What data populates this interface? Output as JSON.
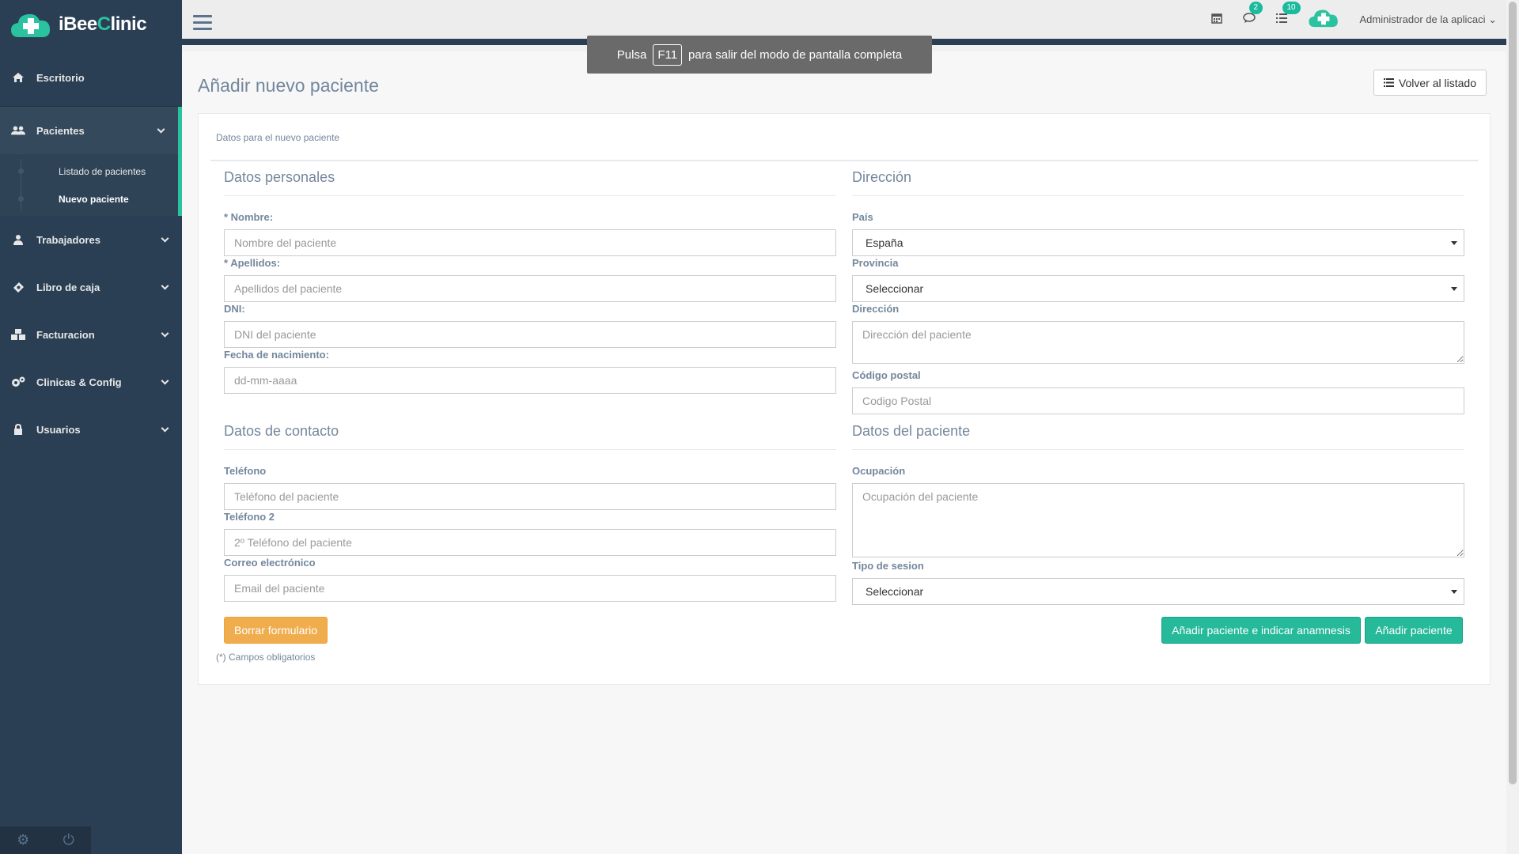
{
  "app": {
    "logo_prefix": "iBee",
    "logo_c": "C",
    "logo_suffix": "linic"
  },
  "sidebar": {
    "items": [
      {
        "label": "Escritorio",
        "icon": "home-icon"
      },
      {
        "label": "Pacientes",
        "icon": "users-icon"
      },
      {
        "label": "Trabajadores",
        "icon": "user-md-icon"
      },
      {
        "label": "Libro de caja",
        "icon": "money-icon"
      },
      {
        "label": "Facturacion",
        "icon": "cubes-icon"
      },
      {
        "label": "Clinicas & Config",
        "icon": "cogs-icon"
      },
      {
        "label": "Usuarios",
        "icon": "lock-icon"
      }
    ],
    "submenu": [
      {
        "label": "Listado de pacientes"
      },
      {
        "label": "Nuevo paciente"
      }
    ]
  },
  "topbar": {
    "messages_count": "2",
    "tasks_count": "10",
    "user_name": "Administrador de la aplicaci"
  },
  "toast": {
    "prefix": "Pulsa",
    "key": "F11",
    "suffix": "para salir del modo de pantalla completa"
  },
  "page": {
    "title": "Añadir nuevo paciente",
    "back_button": "Volver al listado",
    "panel_title": "Datos para el nuevo paciente"
  },
  "personal": {
    "title": "Datos personales",
    "nombre_label": "* Nombre:",
    "nombre_placeholder": "Nombre del paciente",
    "apellidos_label": "* Apellidos:",
    "apellidos_placeholder": "Apellidos del paciente",
    "dni_label": "DNI:",
    "dni_placeholder": "DNI del paciente",
    "fecha_label": "Fecha de nacimiento:",
    "fecha_placeholder": "dd-mm-aaaa"
  },
  "direccion": {
    "title": "Dirección",
    "pais_label": "País",
    "pais_value": "España",
    "provincia_label": "Provincia",
    "provincia_value": "Seleccionar",
    "direccion_label": "Dirección",
    "direccion_placeholder": "Dirección del paciente",
    "cp_label": "Código postal",
    "cp_placeholder": "Codigo Postal"
  },
  "contacto": {
    "title": "Datos de contacto",
    "telefono_label": "Teléfono",
    "telefono_placeholder": "Teléfono del paciente",
    "telefono2_label": "Teléfono 2",
    "telefono2_placeholder": "2º Teléfono del paciente",
    "email_label": "Correo electrónico",
    "email_placeholder": "Email del paciente"
  },
  "paciente": {
    "title": "Datos del paciente",
    "ocupacion_label": "Ocupación",
    "ocupacion_placeholder": "Ocupación del paciente",
    "sesion_label": "Tipo de sesion",
    "sesion_value": "Seleccionar"
  },
  "actions": {
    "reset": "Borrar formulario",
    "add_anamnesis": "Añadir paciente e indicar anamnesis",
    "add": "Añadir paciente",
    "required_note": "(*) Campos obligatorios"
  },
  "colors": {
    "sidebar": "#2a3f54",
    "accent": "#26b99a",
    "warning": "#f0ad4e"
  }
}
